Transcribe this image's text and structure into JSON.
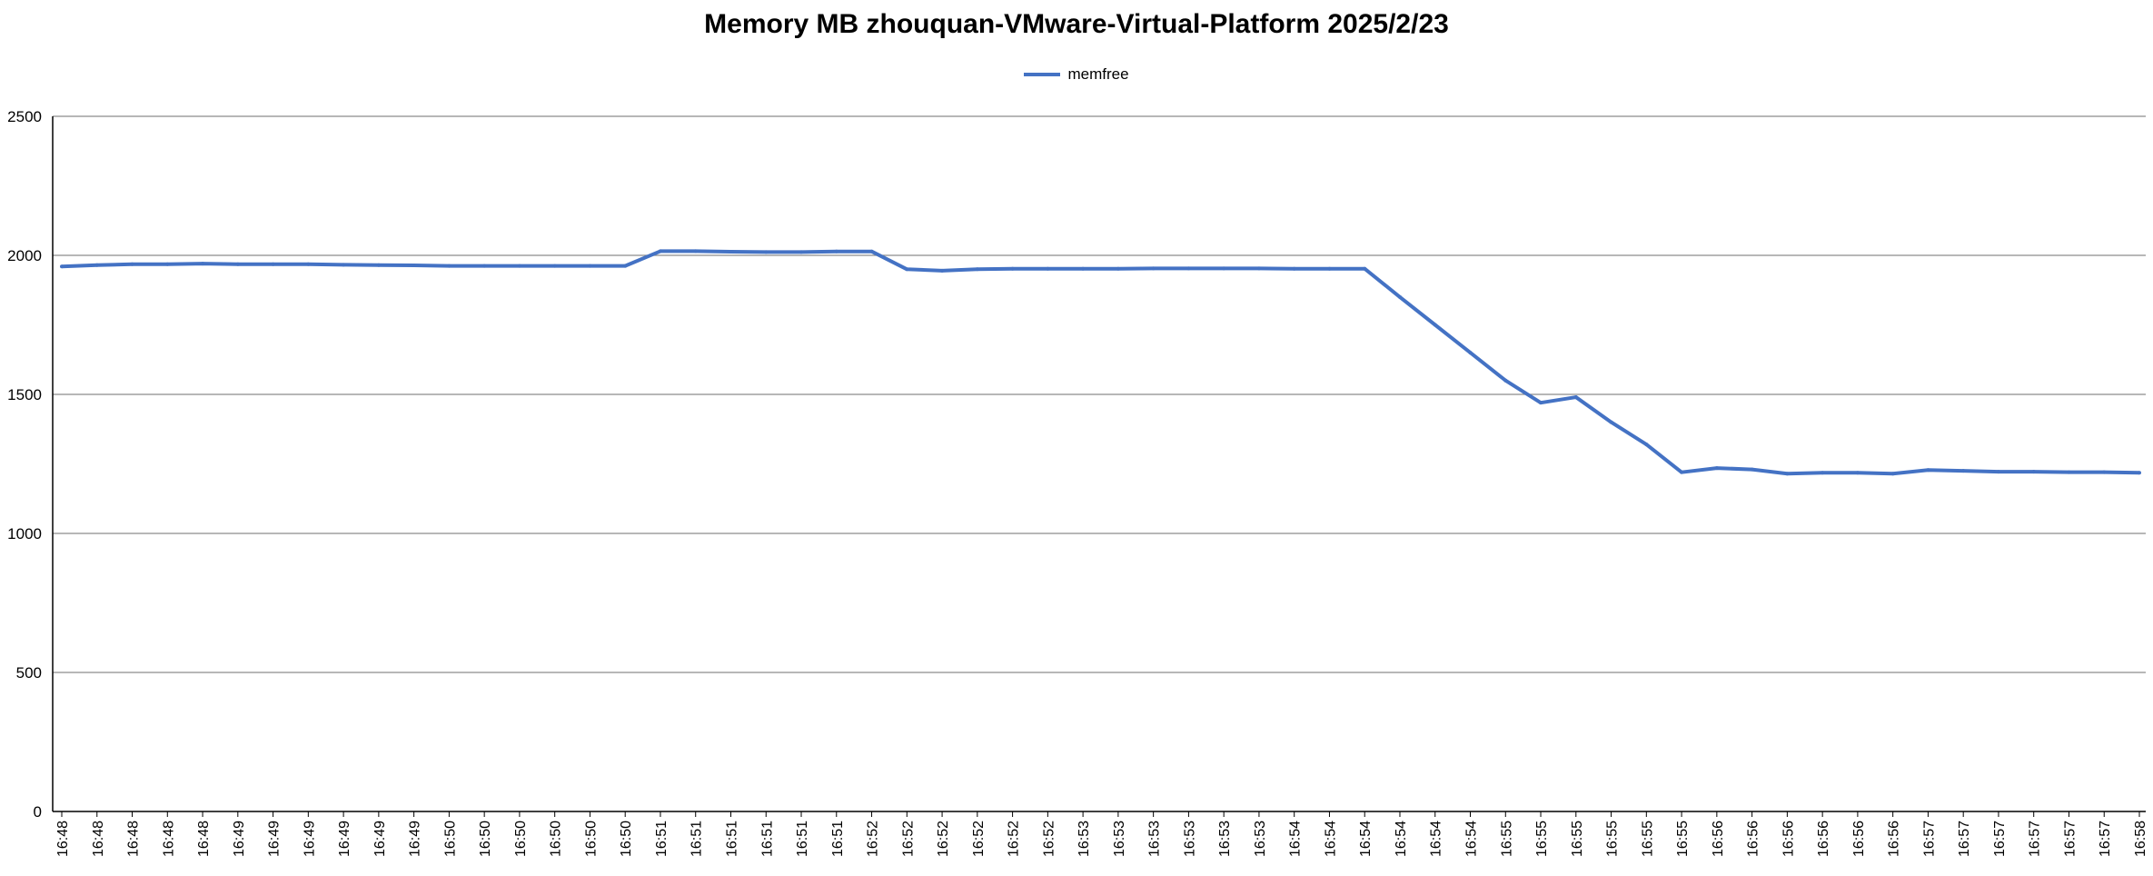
{
  "chart_data": {
    "type": "line",
    "title": "Memory MB zhouquan-VMware-Virtual-Platform  2025/2/23",
    "xlabel": "",
    "ylabel": "",
    "ylim": [
      0,
      2500
    ],
    "yticks": [
      0,
      500,
      1000,
      1500,
      2000,
      2500
    ],
    "grid": true,
    "legend": "top-center",
    "categories": [
      "16:48",
      "16:48",
      "16:48",
      "16:48",
      "16:48",
      "16:49",
      "16:49",
      "16:49",
      "16:49",
      "16:49",
      "16:49",
      "16:50",
      "16:50",
      "16:50",
      "16:50",
      "16:50",
      "16:50",
      "16:51",
      "16:51",
      "16:51",
      "16:51",
      "16:51",
      "16:51",
      "16:52",
      "16:52",
      "16:52",
      "16:52",
      "16:52",
      "16:52",
      "16:53",
      "16:53",
      "16:53",
      "16:53",
      "16:53",
      "16:53",
      "16:54",
      "16:54",
      "16:54",
      "16:54",
      "16:54",
      "16:54",
      "16:55",
      "16:55",
      "16:55",
      "16:55",
      "16:55",
      "16:55",
      "16:56",
      "16:56",
      "16:56",
      "16:56",
      "16:56",
      "16:56",
      "16:57",
      "16:57",
      "16:57",
      "16:57",
      "16:57",
      "16:57",
      "16:58"
    ],
    "series": [
      {
        "name": "memfree",
        "color": "#4472c4",
        "values": [
          1960,
          1965,
          1968,
          1968,
          1970,
          1968,
          1968,
          1968,
          1966,
          1965,
          1964,
          1962,
          1962,
          1962,
          1962,
          1962,
          1962,
          2015,
          2015,
          2013,
          2012,
          2012,
          2014,
          2014,
          1950,
          1945,
          1950,
          1952,
          1952,
          1952,
          1952,
          1953,
          1953,
          1953,
          1953,
          1952,
          1952,
          1952,
          1850,
          1750,
          1650,
          1550,
          1470,
          1490,
          1400,
          1320,
          1220,
          1235,
          1230,
          1215,
          1218,
          1218,
          1215,
          1228,
          1225,
          1222,
          1222,
          1220,
          1220,
          1218
        ]
      }
    ]
  }
}
